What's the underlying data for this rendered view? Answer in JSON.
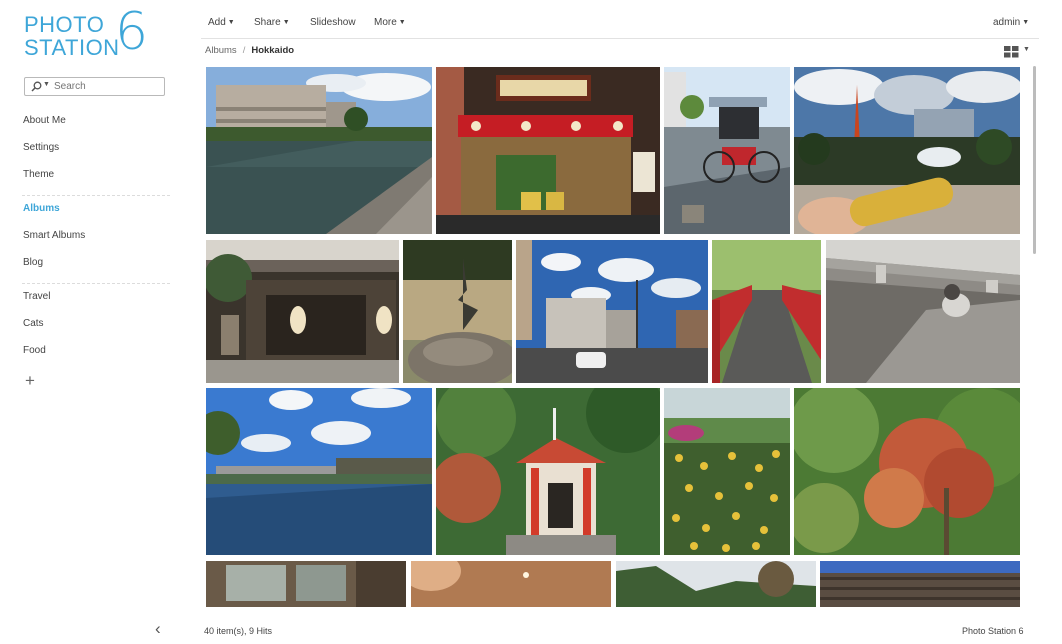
{
  "logo": {
    "line1": "PHOTO",
    "line2": "STATION",
    "number": "6"
  },
  "search": {
    "placeholder": "Search"
  },
  "sidebar": {
    "items": [
      {
        "label": "About Me"
      },
      {
        "label": "Settings"
      },
      {
        "label": "Theme"
      },
      {
        "label": "Albums"
      },
      {
        "label": "Smart Albums"
      },
      {
        "label": "Blog"
      },
      {
        "label": "Travel"
      },
      {
        "label": "Cats"
      },
      {
        "label": "Food"
      }
    ],
    "add": "+",
    "collapse": "‹"
  },
  "toolbar": {
    "add": "Add",
    "share": "Share",
    "slideshow": "Slideshow",
    "more": "More",
    "user": "admin"
  },
  "breadcrumb": {
    "root": "Albums",
    "separator": "/",
    "current": "Hokkaido"
  },
  "footer": {
    "count": "40 item(s), 9 Hits",
    "brand": "Photo Station 6"
  },
  "colors": {
    "accent": "#3ea6d8",
    "text": "#444444",
    "divider": "#dcdcdc"
  },
  "photos": [
    {
      "name": "canal-building"
    },
    {
      "name": "shrine-stall"
    },
    {
      "name": "rickshaw"
    },
    {
      "name": "tv-tower-corn"
    },
    {
      "name": "wooden-inn"
    },
    {
      "name": "crane-statue"
    },
    {
      "name": "city-street"
    },
    {
      "name": "red-bridge"
    },
    {
      "name": "cat-under-bridge"
    },
    {
      "name": "river-bridge"
    },
    {
      "name": "red-shrine"
    },
    {
      "name": "flower-garden"
    },
    {
      "name": "autumn-trees"
    },
    {
      "name": "interior-hall"
    },
    {
      "name": "lamp-ceiling"
    },
    {
      "name": "hill-forest"
    },
    {
      "name": "roof-tiles"
    }
  ]
}
